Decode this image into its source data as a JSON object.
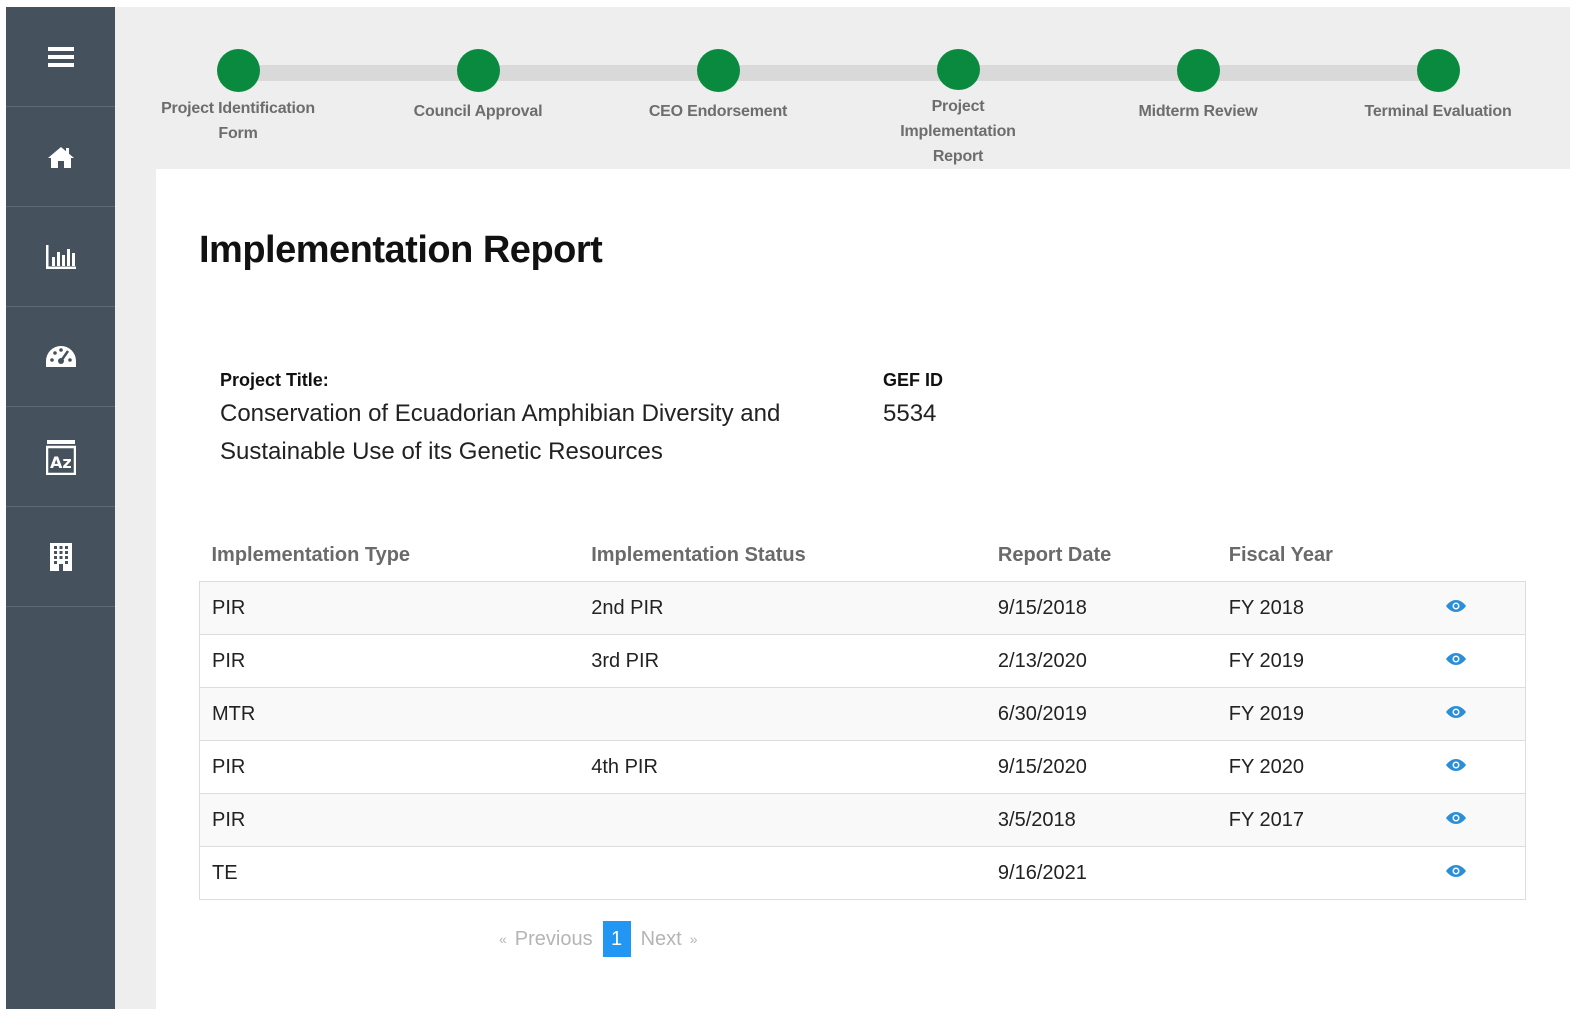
{
  "sidebar": {
    "items": [
      {
        "icon": "menu-icon"
      },
      {
        "icon": "home-icon"
      },
      {
        "icon": "bar-chart-icon"
      },
      {
        "icon": "dashboard-gauge-icon"
      },
      {
        "icon": "az-sort-icon"
      },
      {
        "icon": "building-icon"
      }
    ]
  },
  "stepper": {
    "color": "#0a8a3e",
    "steps": [
      {
        "label": "Project Identification Form"
      },
      {
        "label": "Council Approval"
      },
      {
        "label": "CEO Endorsement"
      },
      {
        "label": "Project Implementation Report"
      },
      {
        "label": "Midterm Review"
      },
      {
        "label": "Terminal Evaluation"
      }
    ]
  },
  "page": {
    "title": "Implementation Report",
    "project_title_label": "Project Title:",
    "project_title_line1": "Conservation of Ecuadorian Amphibian Diversity and",
    "project_title_line2": "Sustainable Use of its Genetic Resources",
    "gef_id_label": "GEF ID",
    "gef_id_value": "5534"
  },
  "table": {
    "headers": [
      "Implementation Type",
      "Implementation Status",
      "Report Date",
      "Fiscal Year",
      ""
    ],
    "rows": [
      {
        "type": "PIR",
        "status": "2nd PIR",
        "date": "9/15/2018",
        "fy": "FY 2018"
      },
      {
        "type": "PIR",
        "status": "3rd PIR",
        "date": "2/13/2020",
        "fy": "FY 2019"
      },
      {
        "type": "MTR",
        "status": "",
        "date": "6/30/2019",
        "fy": "FY 2019"
      },
      {
        "type": "PIR",
        "status": "4th PIR",
        "date": "9/15/2020",
        "fy": "FY 2020"
      },
      {
        "type": "PIR",
        "status": "",
        "date": "3/5/2018",
        "fy": "FY 2017"
      },
      {
        "type": "TE",
        "status": "",
        "date": "9/16/2021",
        "fy": ""
      }
    ],
    "action_icon": "eye-icon",
    "action_color": "#2a8fd8"
  },
  "pagination": {
    "prev_arrow": "«",
    "prev_label": "Previous",
    "current": "1",
    "next_label": "Next",
    "next_arrow": "»"
  }
}
